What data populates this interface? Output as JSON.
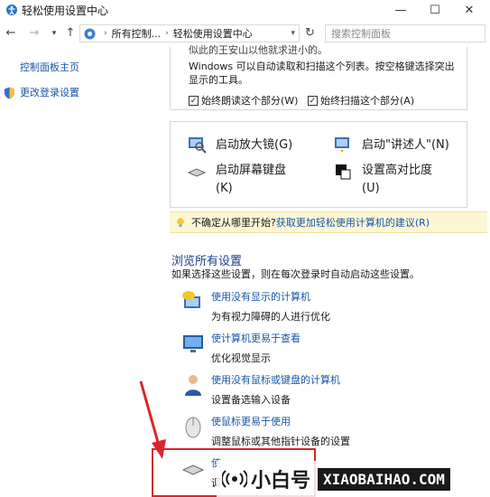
{
  "window": {
    "title": "轻松使用设置中心",
    "minimize": "—",
    "maximize": "☐",
    "close": "✕"
  },
  "address": {
    "crumb_root": "所有控制...",
    "crumb_current": "轻松使用设置中心",
    "search_placeholder": "搜索控制面板"
  },
  "left_pane": {
    "home": "控制面板主页",
    "login": "更改登录设置"
  },
  "quick_access": {
    "cut_text": "似此的王安山以他就求进小的。",
    "description": "Windows 可以自动读取和扫描这个列表。按空格键选择突出显示的工具。",
    "check1": "始终朗读这个部分(W)",
    "check2": "始终扫描这个部分(A)"
  },
  "tools": {
    "magnifier": "启动放大镜(G)",
    "narrator": "启动\"讲述人\"(N)",
    "osk_line1": "启动屏幕键盘",
    "osk_line2": "(K)",
    "hc_line1": "设置高对比度",
    "hc_line2": "(U)"
  },
  "tip": {
    "lead": "不确定从哪里开始?",
    "link": "获取更加轻松使用计算机的建议(R)"
  },
  "browse": {
    "heading": "浏览所有设置",
    "desc": "如果选择这些设置，则在每次登录时自动启动这些设置。"
  },
  "items": [
    {
      "title": "使用没有显示的计算机",
      "desc": "为有视力障碍的人进行优化"
    },
    {
      "title": "使计算机更易于查看",
      "desc": "优化视觉显示"
    },
    {
      "title": "使用没有鼠标或键盘的计算机",
      "desc": "设置备选输入设备"
    },
    {
      "title": "使鼠标更易于使用",
      "desc": "调整鼠标或其他指针设备的设置"
    },
    {
      "title": "使",
      "desc": "调"
    }
  ],
  "watermark": {
    "cn": "小白号",
    "en": "XIAOBAIHAO.COM"
  },
  "colors": {
    "link": "#1a56a8",
    "heading": "#1e3f8c",
    "annotation": "#d8262b",
    "tip_bg": "#fdf6d4"
  }
}
